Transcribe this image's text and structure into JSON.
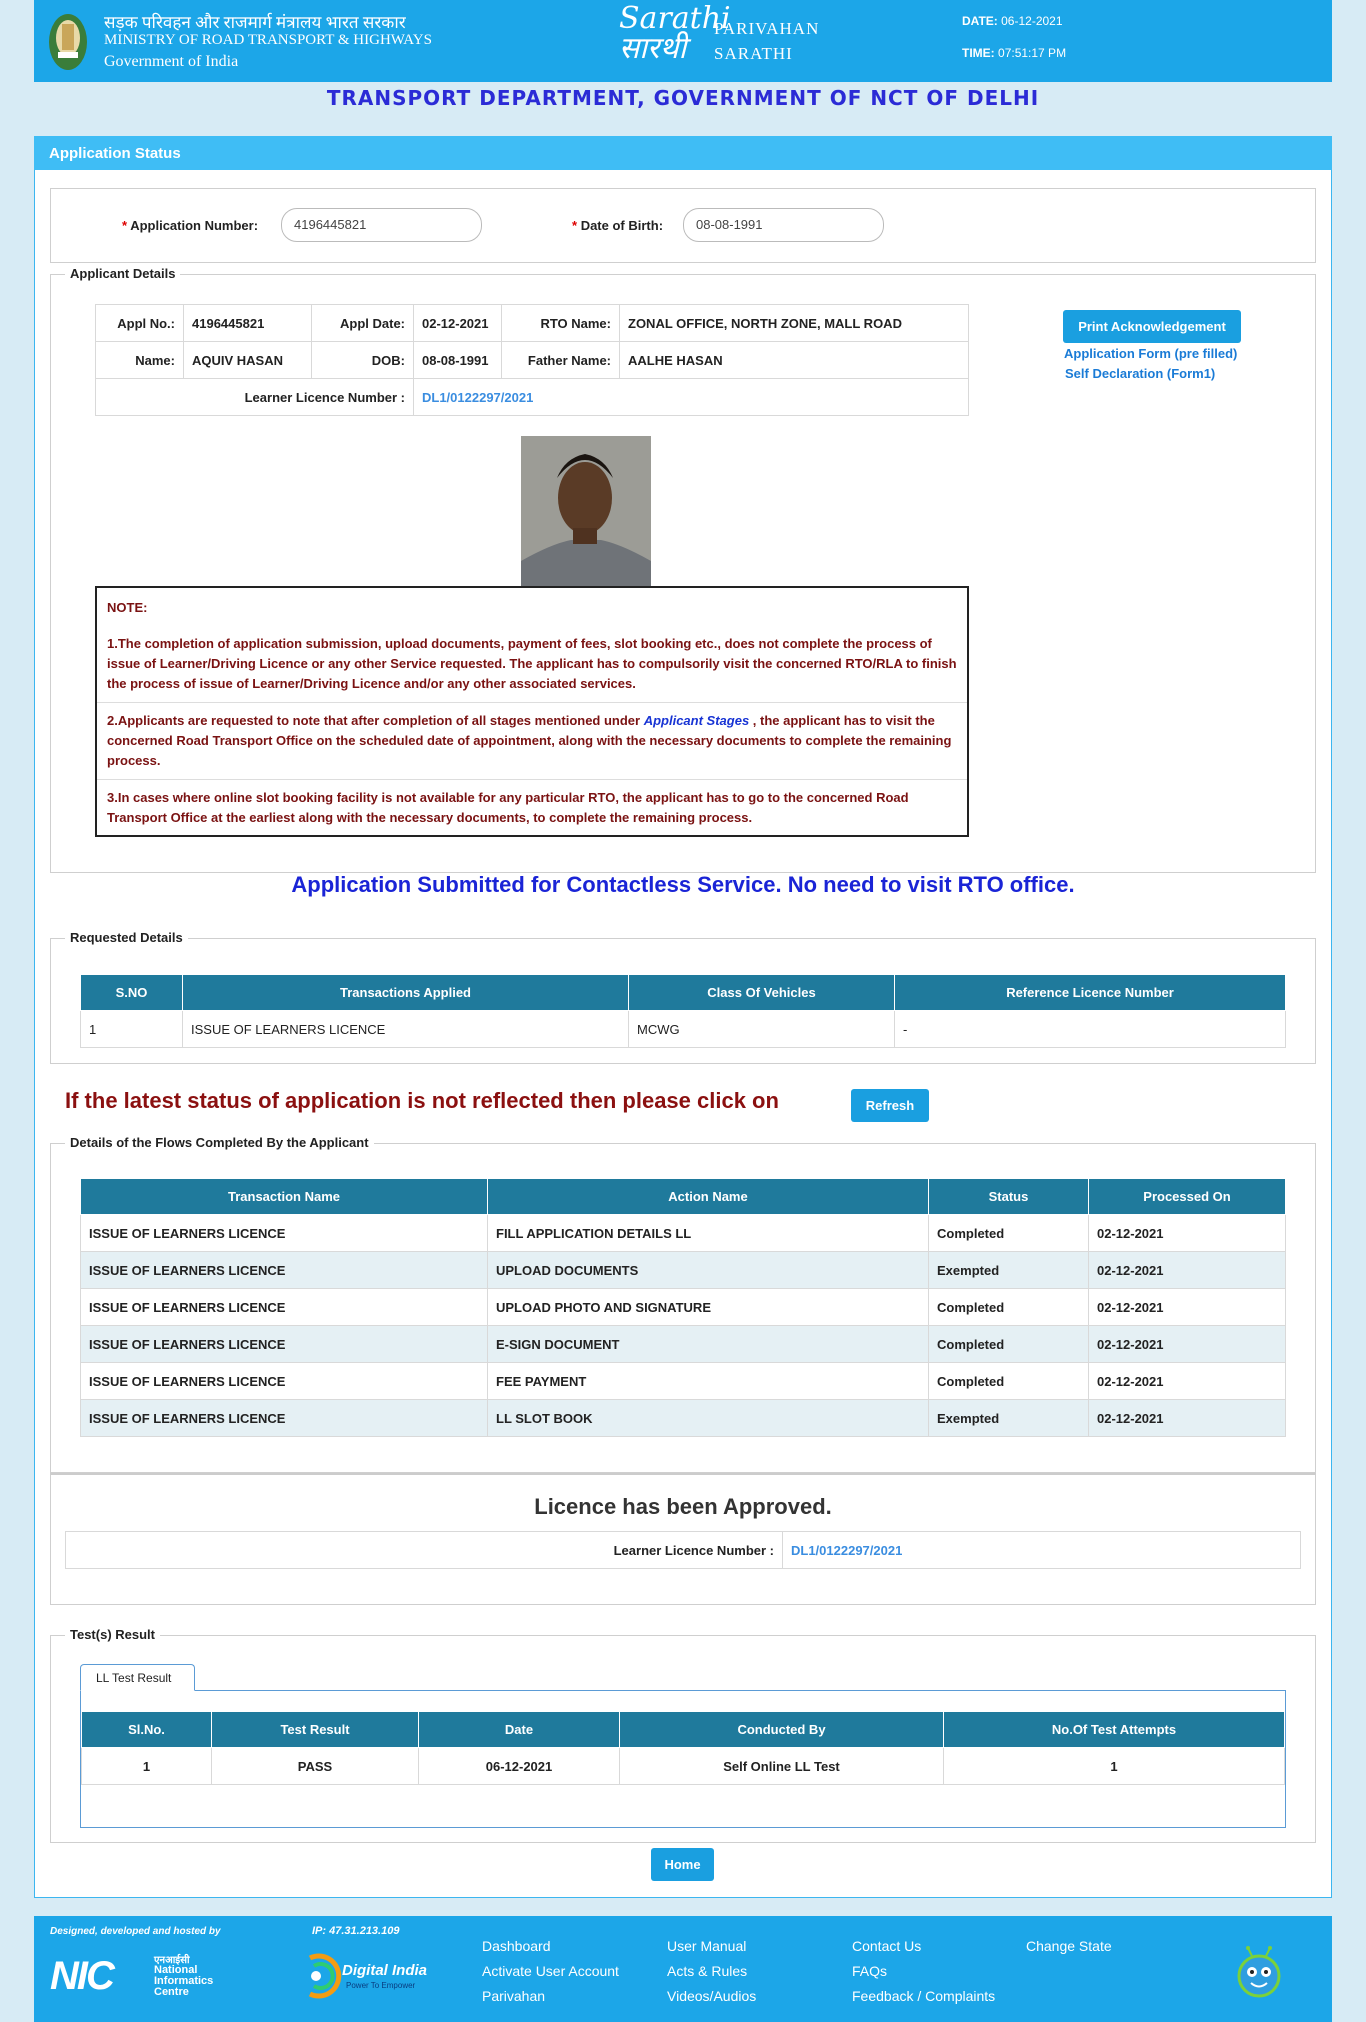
{
  "header": {
    "hindi_title": "सड़क परिवहन और राजमार्ग मंत्रालय भारत सरकार",
    "ministry": "MINISTRY OF ROAD TRANSPORT & HIGHWAYS",
    "gov": "Government of India",
    "logo_line1": "Sarathi",
    "logo_line2": "सारथी",
    "parivahan": "PARIVAHAN",
    "sarathi": "SARATHI",
    "date_label": "DATE:",
    "date": "06-12-2021",
    "time_label": "TIME:",
    "time": "07:51:17 PM"
  },
  "department": "TRANSPORT DEPARTMENT, GOVERNMENT OF NCT OF DELHI",
  "panel_title": "Application Status",
  "search": {
    "app_no_label": "Application Number:",
    "app_no": "4196445821",
    "dob_label": "Date of Birth:",
    "dob": "08-08-1991",
    "required_mark": "*"
  },
  "applicant": {
    "legend": "Applicant Details",
    "appl_no_label": "Appl No.:",
    "appl_no": "4196445821",
    "appl_date_label": "Appl Date:",
    "appl_date": "02-12-2021",
    "rto_label": "RTO Name:",
    "rto": "ZONAL OFFICE, NORTH ZONE, MALL ROAD",
    "name_label": "Name:",
    "name": "AQUIV HASAN",
    "dob_label": "DOB:",
    "dob": "08-08-1991",
    "father_label": "Father  Name:",
    "father": "AALHE HASAN",
    "ll_label": "Learner Licence Number :",
    "ll": "DL1/0122297/2021",
    "print_btn": "Print Acknowledgement",
    "link1": "Application Form (pre filled)",
    "link2": "Self Declaration (Form1)"
  },
  "note": {
    "title": "NOTE:",
    "p1": "1.The completion of application submission, upload documents, payment of fees, slot booking etc., does not complete the process of issue of Learner/Driving Licence or any other Service requested. The applicant has to compulsorily visit the concerned RTO/RLA to finish the process of issue of Learner/Driving Licence and/or any other associated services.",
    "p2_a": "2.Applicants are requested to note that after completion of all stages mentioned under ",
    "p2_link": "Applicant Stages",
    "p2_b": " , the applicant has to visit the concerned Road Transport Office on the scheduled date of appointment, along with the necessary documents to complete the remaining process.",
    "p3": "3.In cases where online slot booking facility is not available for any particular RTO, the applicant has to go to the concerned Road Transport Office at the earliest along with the necessary documents, to complete the remaining process."
  },
  "contactless": "Application Submitted for Contactless Service. No need to visit RTO office.",
  "requested": {
    "legend": "Requested Details",
    "headers": [
      "S.NO",
      "Transactions Applied",
      "Class Of Vehicles",
      "Reference Licence Number"
    ],
    "rows": [
      [
        "1",
        "ISSUE OF LEARNERS LICENCE",
        "MCWG",
        "-"
      ]
    ]
  },
  "refresh": {
    "text": "If the latest status of application is not reflected then please click on",
    "button": "Refresh"
  },
  "flows": {
    "legend": "Details of the Flows Completed By the Applicant",
    "headers": [
      "Transaction Name",
      "Action Name",
      "Status",
      "Processed On"
    ],
    "rows": [
      [
        "ISSUE OF LEARNERS LICENCE",
        "FILL APPLICATION DETAILS LL",
        "Completed",
        "02-12-2021"
      ],
      [
        "ISSUE OF LEARNERS LICENCE",
        "UPLOAD DOCUMENTS",
        "Exempted",
        "02-12-2021"
      ],
      [
        "ISSUE OF LEARNERS LICENCE",
        "UPLOAD PHOTO AND SIGNATURE",
        "Completed",
        "02-12-2021"
      ],
      [
        "ISSUE OF LEARNERS LICENCE",
        "E-SIGN DOCUMENT",
        "Completed",
        "02-12-2021"
      ],
      [
        "ISSUE OF LEARNERS LICENCE",
        "FEE PAYMENT",
        "Completed",
        "02-12-2021"
      ],
      [
        "ISSUE OF LEARNERS LICENCE",
        "LL SLOT BOOK",
        "Exempted",
        "02-12-2021"
      ]
    ]
  },
  "approved": {
    "title": "Licence has been Approved.",
    "ll_label": "Learner Licence Number :",
    "ll": "DL1/0122297/2021"
  },
  "tests": {
    "legend": "Test(s) Result",
    "tab": "LL Test Result",
    "headers": [
      "Sl.No.",
      "Test Result",
      "Date",
      "Conducted By",
      "No.Of Test Attempts"
    ],
    "rows": [
      [
        "1",
        "PASS",
        "06-12-2021",
        "Self Online LL Test",
        "1"
      ]
    ]
  },
  "home_btn": "Home",
  "footer": {
    "designed": "Designed, developed and hosted by",
    "ip": "IP: 47.31.213.109",
    "nic": "NIC",
    "nic_hindi": "एनआईसी",
    "nic_l1": "National",
    "nic_l2": "Informatics",
    "nic_l3": "Centre",
    "di": "Digital India",
    "di_sub": "Power To Empower",
    "col1": [
      "Dashboard",
      "Activate User Account",
      "Parivahan"
    ],
    "col2": [
      "User Manual",
      "Acts & Rules",
      "Videos/Audios"
    ],
    "col3": [
      "Contact Us",
      "FAQs",
      "Feedback / Complaints"
    ],
    "col4": [
      "Change State"
    ]
  }
}
